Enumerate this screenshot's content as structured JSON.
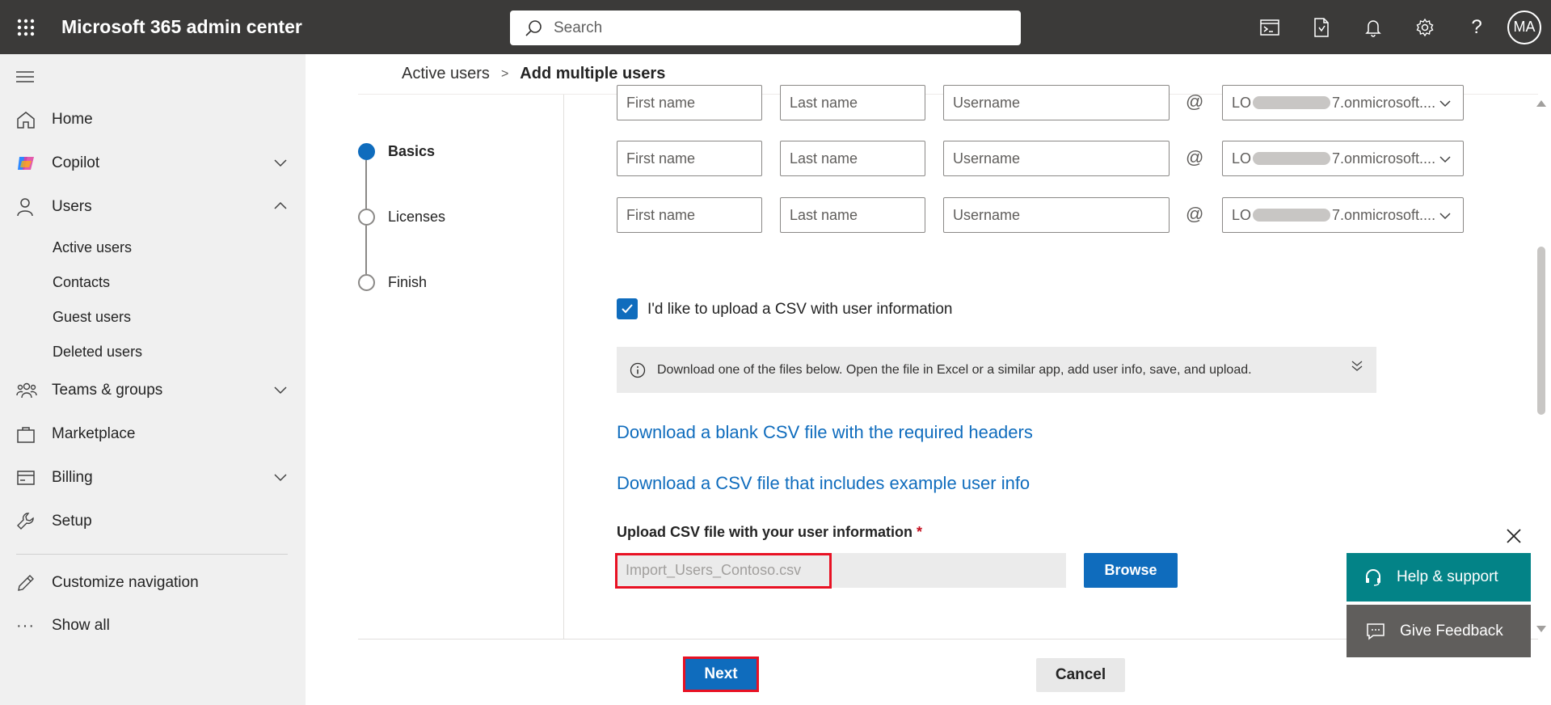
{
  "app": {
    "title": "Microsoft 365 admin center"
  },
  "search": {
    "placeholder": "Search"
  },
  "topbar": {
    "avatar_initials": "MA"
  },
  "nav": {
    "items": [
      {
        "label": "Home"
      },
      {
        "label": "Copilot"
      },
      {
        "label": "Users"
      },
      {
        "label": "Teams & groups"
      },
      {
        "label": "Marketplace"
      },
      {
        "label": "Billing"
      },
      {
        "label": "Setup"
      },
      {
        "label": "Customize navigation"
      },
      {
        "label": "Show all"
      }
    ],
    "users_sub": [
      {
        "label": "Active users"
      },
      {
        "label": "Contacts"
      },
      {
        "label": "Guest users"
      },
      {
        "label": "Deleted users"
      }
    ]
  },
  "breadcrumb": {
    "parent": "Active users",
    "current": "Add multiple users"
  },
  "steps": [
    {
      "label": "Basics"
    },
    {
      "label": "Licenses"
    },
    {
      "label": "Finish"
    }
  ],
  "rows": {
    "first_name_placeholder": "First name",
    "last_name_placeholder": "Last name",
    "username_placeholder": "Username",
    "at_symbol": "@",
    "domain_prefix": "LO",
    "domain_suffix": "7.onmicrosoft...."
  },
  "csv": {
    "checkbox_label": "I'd like to upload a CSV with user information",
    "info_text": "Download one of the files below. Open the file in Excel or a similar app, add user info, save, and upload.",
    "link_blank": "Download a blank CSV file with the required headers",
    "link_example": "Download a CSV file that includes example user info",
    "upload_label": "Upload CSV file with your user information",
    "required_mark": "*",
    "file_name": "Import_Users_Contoso.csv",
    "browse_label": "Browse"
  },
  "footer": {
    "next_label": "Next",
    "cancel_label": "Cancel"
  },
  "help": {
    "help_label": "Help & support",
    "feedback_label": "Give Feedback"
  },
  "colors": {
    "topbar": "#3b3a39",
    "accent": "#0f6cbd",
    "highlight": "#e81123",
    "help": "#038387",
    "feedback": "#605e5c"
  }
}
